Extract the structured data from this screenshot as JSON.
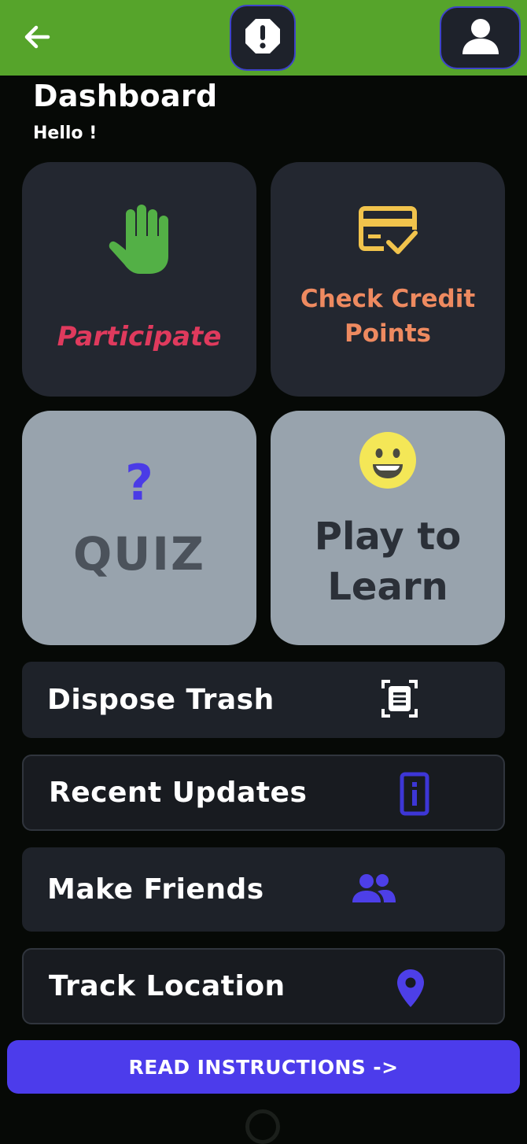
{
  "header": {
    "back_icon": "arrow-left-icon",
    "alert_icon": "octagon-alert-icon",
    "profile_icon": "user-icon",
    "bar_color": "#56a42b"
  },
  "page": {
    "title": "Dashboard",
    "greeting": "Hello !"
  },
  "tiles": [
    {
      "label": "Participate",
      "icon": "raised-hand-icon",
      "color": "#df3a5d"
    },
    {
      "label_line1": "Check Credit",
      "label_line2": "Points",
      "icon": "credit-card-check-icon",
      "color": "#ee8a60"
    },
    {
      "label": "QUIZ",
      "icon": "question-mark-icon",
      "icon_text": "?",
      "color": "#4b525b"
    },
    {
      "label_line1": "Play to",
      "label_line2": "Learn",
      "icon": "smiley-face-icon",
      "color": "#2b3038"
    }
  ],
  "rows": [
    {
      "label": "Dispose Trash",
      "icon": "scan-document-icon"
    },
    {
      "label": "Recent Updates",
      "icon": "info-phone-icon"
    },
    {
      "label": "Make Friends",
      "icon": "people-icon"
    },
    {
      "label": "Track Location",
      "icon": "location-pin-icon"
    }
  ],
  "cta": {
    "label": "READ INSTRUCTIONS ->",
    "color": "#4c3ceb"
  }
}
